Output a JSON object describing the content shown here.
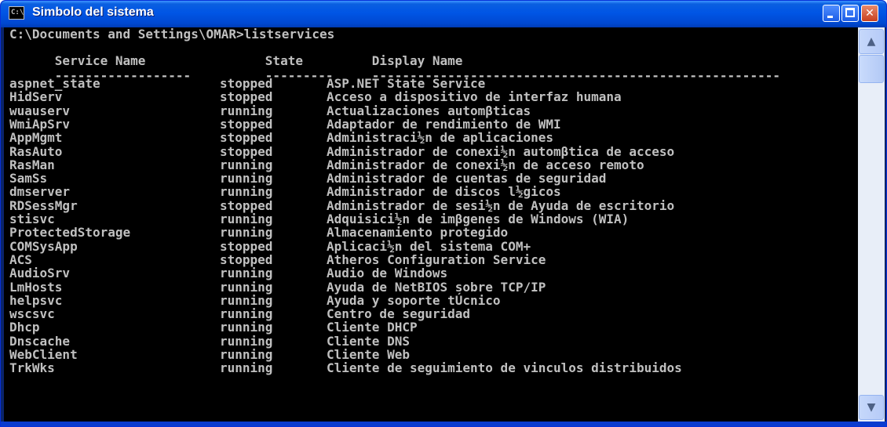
{
  "window": {
    "title": "Simbolo del sistema",
    "icon_text": "C:\\"
  },
  "console": {
    "prompt_line": "C:\\Documents and Settings\\OMAR>listservices",
    "header": [
      "Service Name",
      "State",
      "Display Name"
    ],
    "separator": [
      "------------------",
      "---------",
      "------------------------------------------------------"
    ],
    "rows": [
      [
        "aspnet_state",
        "stopped",
        "ASP.NET State Service"
      ],
      [
        "HidServ",
        "stopped",
        "Acceso a dispositivo de interfaz humana"
      ],
      [
        "wuauserv",
        "running",
        "Actualizaciones automβticas"
      ],
      [
        "WmiApSrv",
        "stopped",
        "Adaptador de rendimiento de WMI"
      ],
      [
        "AppMgmt",
        "stopped",
        "Administraci½n de aplicaciones"
      ],
      [
        "RasAuto",
        "stopped",
        "Administrador de conexi½n automβtica de acceso"
      ],
      [
        "RasMan",
        "running",
        "Administrador de conexi½n de acceso remoto"
      ],
      [
        "SamSs",
        "running",
        "Administrador de cuentas de seguridad"
      ],
      [
        "dmserver",
        "running",
        "Administrador de discos l½gicos"
      ],
      [
        "RDSessMgr",
        "stopped",
        "Administrador de sesi½n de Ayuda de escritorio"
      ],
      [
        "stisvc",
        "running",
        "Adquisici½n de imβgenes de Windows (WIA)"
      ],
      [
        "ProtectedStorage",
        "running",
        "Almacenamiento protegido"
      ],
      [
        "COMSysApp",
        "stopped",
        "Aplicaci½n del sistema COM+"
      ],
      [
        "ACS",
        "stopped",
        "Atheros Configuration Service"
      ],
      [
        "AudioSrv",
        "running",
        "Audio de Windows"
      ],
      [
        "LmHosts",
        "running",
        "Ayuda de NetBIOS sobre TCP/IP"
      ],
      [
        "helpsvc",
        "running",
        "Ayuda y soporte tÚcnico"
      ],
      [
        "wscsvc",
        "running",
        "Centro de seguridad"
      ],
      [
        "Dhcp",
        "running",
        "Cliente DHCP"
      ],
      [
        "Dnscache",
        "running",
        "Cliente DNS"
      ],
      [
        "WebClient",
        "running",
        "Cliente Web"
      ],
      [
        "TrkWks",
        "running",
        "Cliente de seguimiento de vinculos distribuidos"
      ]
    ]
  },
  "controls": {
    "minimize": "minimize-icon",
    "maximize": "maximize-icon",
    "close": "close-icon",
    "close_glyph": "✕",
    "scroll_up": "▲",
    "scroll_down": "▼"
  },
  "colors": {
    "console_bg": "#000000",
    "console_text": "#c0c0c0",
    "titlebar": "#0055e5"
  }
}
